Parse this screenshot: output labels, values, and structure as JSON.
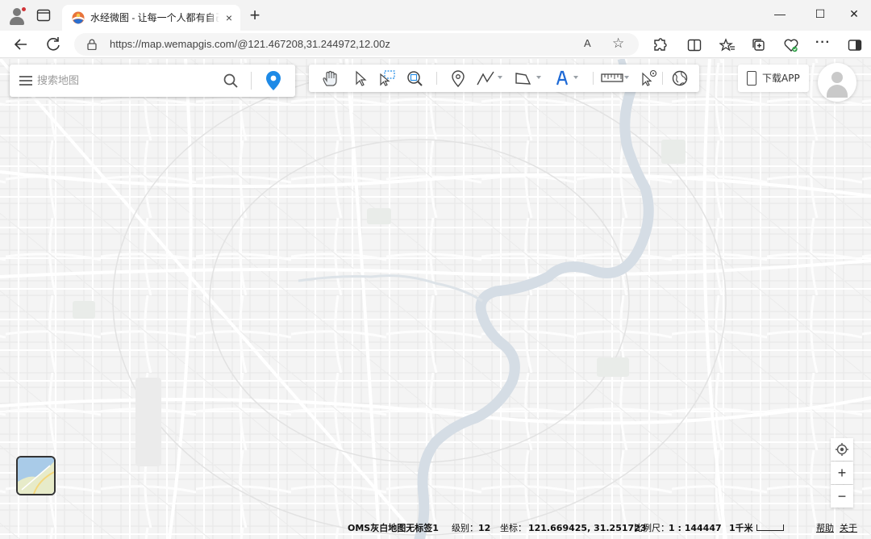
{
  "browser": {
    "tab_title": "水经微图 - 让每一个人都有自己的地图",
    "tab_close": "×",
    "new_tab": "+",
    "url": "https://map.wemapgis.com/@121.467208,31.244972,12.00z",
    "read_aloud": "A",
    "star": "☆",
    "window_controls": {
      "minimize": "—",
      "maximize": "☐",
      "close": "✕"
    },
    "more_label": "···"
  },
  "search": {
    "placeholder": "搜索地图"
  },
  "toolbar": {
    "tools": [
      "pan-hand",
      "select-arrow",
      "box-select",
      "zoom-box",
      "marker",
      "polyline",
      "polygon",
      "text",
      "measure",
      "identify",
      "globe"
    ]
  },
  "download_app": {
    "label": "下载APP"
  },
  "zoom_controls": {
    "locate": "◎",
    "zoom_in": "+",
    "zoom_out": "−"
  },
  "status": {
    "layer_name": "OMS灰白地图无标签1",
    "level_label": "级别：",
    "level_value": "12",
    "coord_label": "坐标：",
    "coord_value": "121.669425, 31.251723",
    "ratio_label": "比例尺：",
    "ratio_value": "1 : 144447",
    "scale_label": "1千米",
    "help": "帮助",
    "about": "关于"
  },
  "colors": {
    "river": "#d5dde5",
    "map_bg": "#f4f4f4",
    "accent_blue": "#1e8ae6"
  }
}
